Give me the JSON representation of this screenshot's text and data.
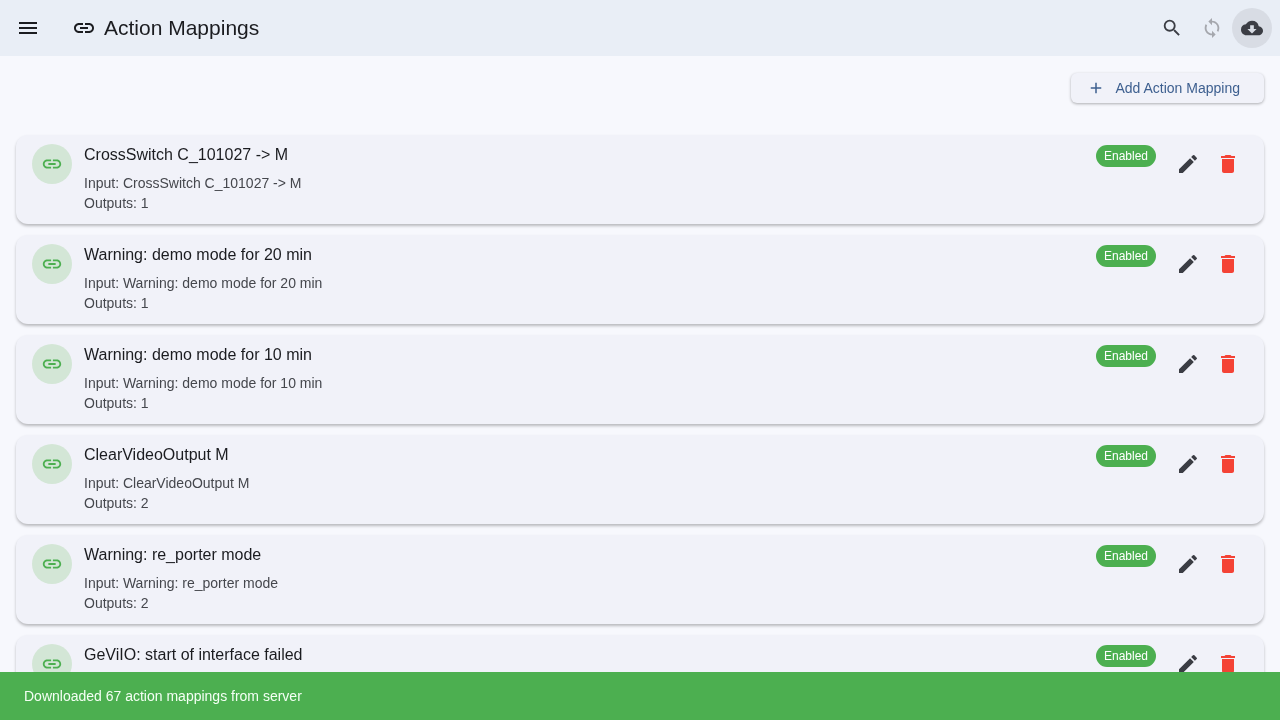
{
  "app_bar": {
    "title": "Action Mappings",
    "actions": [
      {
        "kind": "search",
        "disabled": false,
        "active": false
      },
      {
        "kind": "sync",
        "disabled": true,
        "active": false
      },
      {
        "kind": "download",
        "disabled": false,
        "active": true
      }
    ]
  },
  "add_button": {
    "label": "Add Action Mapping"
  },
  "mappings": [
    {
      "title": "CrossSwitch C_101027 -> M",
      "input": "Input: CrossSwitch C_101027 -> M",
      "outputs": "Outputs: 1",
      "status": "Enabled",
      "enabled": true
    },
    {
      "title": "Warning: demo mode for 20 min",
      "input": "Input: Warning: demo mode for 20 min",
      "outputs": "Outputs: 1",
      "status": "Enabled",
      "enabled": true
    },
    {
      "title": "Warning: demo mode for 10 min",
      "input": "Input: Warning: demo mode for 10 min",
      "outputs": "Outputs: 1",
      "status": "Enabled",
      "enabled": true
    },
    {
      "title": "ClearVideoOutput M",
      "input": "Input: ClearVideoOutput M",
      "outputs": "Outputs: 2",
      "status": "Enabled",
      "enabled": true
    },
    {
      "title": "Warning: re_porter mode",
      "input": "Input: Warning: re_porter mode",
      "outputs": "Outputs: 2",
      "status": "Enabled",
      "enabled": true
    },
    {
      "title": "GeViIO: start of interface failed",
      "status": "Enabled",
      "enabled": true
    }
  ],
  "snackbar": {
    "message": "Downloaded 67 action mappings from server"
  }
}
